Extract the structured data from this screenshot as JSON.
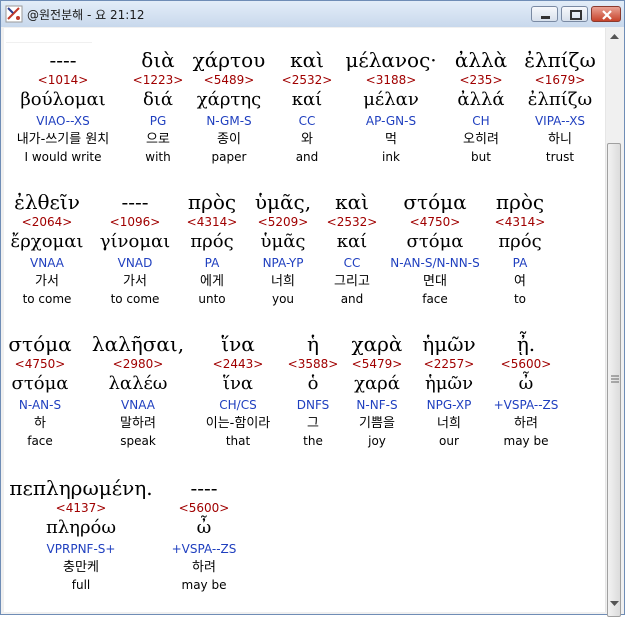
{
  "window": {
    "title": "@원전분해 - 요 21:12"
  },
  "colors": {
    "strong": "#a00000",
    "parsing": "#1f3fbf",
    "text": "#000000"
  },
  "rows": [
    [
      {
        "greek": "----",
        "strong": "<1014>",
        "lemma": "βούλομαι",
        "parsing": "VIAO--XS",
        "korean": "내가-쓰기를 원치",
        "english": "I would write"
      },
      {
        "greek": "διὰ",
        "strong": "<1223>",
        "lemma": "διά",
        "parsing": "PG",
        "korean": "으로",
        "english": "with"
      },
      {
        "greek": "χάρτου",
        "strong": "<5489>",
        "lemma": "χάρτης",
        "parsing": "N-GM-S",
        "korean": "종이",
        "english": "paper"
      },
      {
        "greek": "καὶ",
        "strong": "<2532>",
        "lemma": "καί",
        "parsing": "CC",
        "korean": "와",
        "english": "and"
      },
      {
        "greek": "μέλανος·",
        "strong": "<3188>",
        "lemma": "μέλαν",
        "parsing": "AP-GN-S",
        "korean": "먹",
        "english": "ink"
      },
      {
        "greek": "ἀλλὰ",
        "strong": "<235>",
        "lemma": "ἀλλά",
        "parsing": "CH",
        "korean": "오히려",
        "english": "but"
      },
      {
        "greek": "ἐλπίζω",
        "strong": "<1679>",
        "lemma": "ἐλπίζω",
        "parsing": "VIPA--XS",
        "korean": "하니",
        "english": "trust"
      }
    ],
    [
      {
        "greek": "ἐλθεῖν",
        "strong": "<2064>",
        "lemma": "ἔρχομαι",
        "parsing": "VNAA",
        "korean": "가서",
        "english": "to come"
      },
      {
        "greek": "----",
        "strong": "<1096>",
        "lemma": "γίνομαι",
        "parsing": "VNAD",
        "korean": "가서",
        "english": "to come"
      },
      {
        "greek": "πρὸς",
        "strong": "<4314>",
        "lemma": "πρός",
        "parsing": "PA",
        "korean": "에게",
        "english": "unto"
      },
      {
        "greek": "ὑμᾶς,",
        "strong": "<5209>",
        "lemma": "ὑμᾶς",
        "parsing": "NPA-YP",
        "korean": "너희",
        "english": "you"
      },
      {
        "greek": "καὶ",
        "strong": "<2532>",
        "lemma": "καί",
        "parsing": "CC",
        "korean": "그리고",
        "english": "and"
      },
      {
        "greek": "στόμα",
        "strong": "<4750>",
        "lemma": "στόμα",
        "parsing": "N-AN-S/N-NN-S",
        "korean": "면대",
        "english": "face"
      },
      {
        "greek": "πρὸς",
        "strong": "<4314>",
        "lemma": "πρός",
        "parsing": "PA",
        "korean": "여",
        "english": "to"
      }
    ],
    [
      {
        "greek": "στόμα",
        "strong": "<4750>",
        "lemma": "στόμα",
        "parsing": "N-AN-S",
        "korean": "하",
        "english": "face"
      },
      {
        "greek": "λαλῆσαι,",
        "strong": "<2980>",
        "lemma": "λαλέω",
        "parsing": "VNAA",
        "korean": "말하려",
        "english": "speak"
      },
      {
        "greek": "ἵνα",
        "strong": "<2443>",
        "lemma": "ἵνα",
        "parsing": "CH/CS",
        "korean": "이는-함이라",
        "english": "that"
      },
      {
        "greek": "ἡ",
        "strong": "<3588>",
        "lemma": "ὁ",
        "parsing": "DNFS",
        "korean": "그",
        "english": "the"
      },
      {
        "greek": "χαρὰ",
        "strong": "<5479>",
        "lemma": "χαρά",
        "parsing": "N-NF-S",
        "korean": "기쁨을",
        "english": "joy"
      },
      {
        "greek": "ἡμῶν",
        "strong": "<2257>",
        "lemma": "ἡμῶν",
        "parsing": "NPG-XP",
        "korean": "너희",
        "english": "our"
      },
      {
        "greek": "ᾖ.",
        "strong": "<5600>",
        "lemma": "ὦ",
        "parsing": "+VSPA--ZS",
        "korean": "하려",
        "english": "may be"
      }
    ],
    [
      {
        "greek": "πεπληρωμένη.",
        "strong": "<4137>",
        "lemma": "πληρόω",
        "parsing": "VPRPNF-S+",
        "korean": "충만케",
        "english": "full"
      },
      {
        "greek": "----",
        "strong": "<5600>",
        "lemma": "ὦ",
        "parsing": "+VSPA--ZS",
        "korean": "하려",
        "english": "may be"
      }
    ]
  ]
}
